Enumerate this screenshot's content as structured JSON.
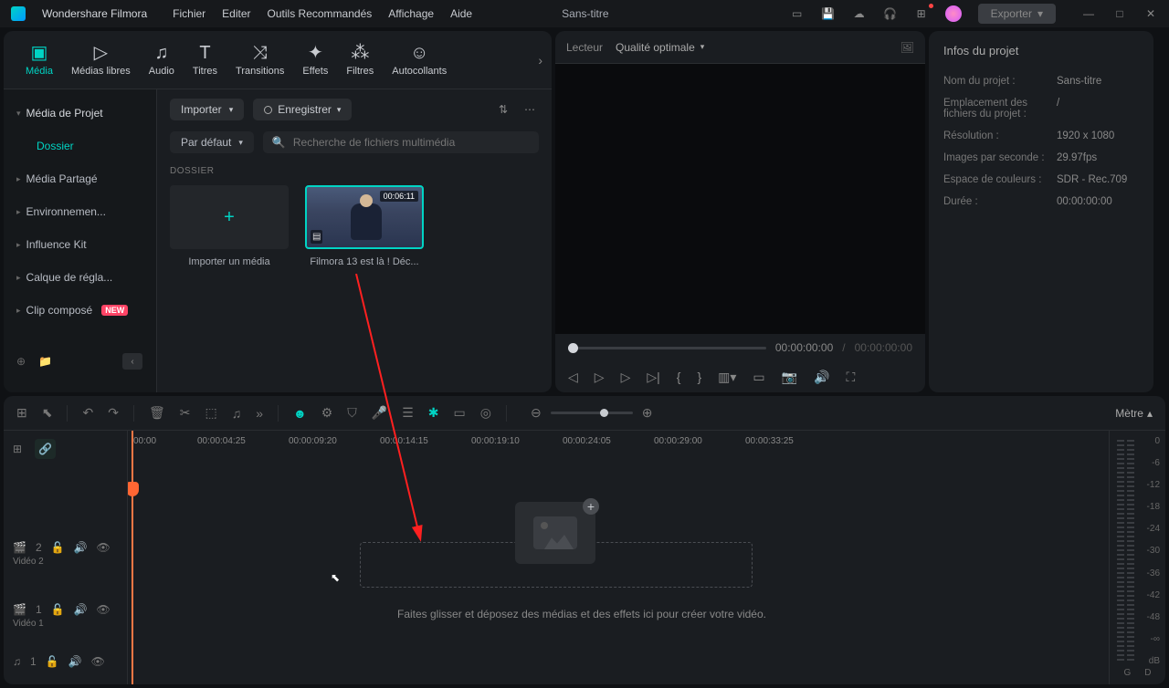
{
  "titlebar": {
    "app_name": "Wondershare Filmora",
    "menus": [
      "Fichier",
      "Editer",
      "Outils Recommandés",
      "Affichage",
      "Aide"
    ],
    "title": "Sans-titre",
    "export_label": "Exporter"
  },
  "media_tabs": [
    {
      "icon": "▣",
      "label": "Média",
      "active": true
    },
    {
      "icon": "▢",
      "label": "Médias libres"
    },
    {
      "icon": "♫",
      "label": "Audio"
    },
    {
      "icon": "T",
      "label": "Titres"
    },
    {
      "icon": "⇄",
      "label": "Transitions"
    },
    {
      "icon": "✦",
      "label": "Effets"
    },
    {
      "icon": "❄",
      "label": "Filtres"
    },
    {
      "icon": "☺",
      "label": "Autocollants"
    }
  ],
  "sidebar": {
    "items": [
      {
        "label": "Média de Projet",
        "caret": true,
        "bold": true
      },
      {
        "label": "Dossier",
        "sub": true,
        "active": true
      },
      {
        "label": "Média Partagé",
        "caret": true
      },
      {
        "label": "Environnemen...",
        "caret": true
      },
      {
        "label": "Influence Kit",
        "caret": true
      },
      {
        "label": "Calque de régla...",
        "caret": true
      },
      {
        "label": "Clip composé",
        "caret": true,
        "new": true
      }
    ]
  },
  "content": {
    "import_label": "Importer",
    "record_label": "Enregistrer",
    "sort_label": "Par défaut",
    "search_placeholder": "Recherche de fichiers multimédia",
    "section_label": "DOSSIER",
    "import_tile_label": "Importer un média",
    "clip_name": "Filmora 13 est là ! Déc...",
    "clip_duration": "00:06:11"
  },
  "preview": {
    "player_label": "Lecteur",
    "quality_label": "Qualité optimale",
    "current_time": "00:00:00:00",
    "total_time": "00:00:00:00"
  },
  "info_panel": {
    "title": "Infos du projet",
    "rows": [
      {
        "k": "Nom du projet :",
        "v": "Sans-titre"
      },
      {
        "k": "Emplacement des fichiers du projet :",
        "v": "/"
      },
      {
        "k": "Résolution :",
        "v": "1920 x 1080"
      },
      {
        "k": "Images par seconde :",
        "v": "29.97fps"
      },
      {
        "k": "Espace de couleurs :",
        "v": "SDR - Rec.709"
      },
      {
        "k": "Durée :",
        "v": "00:00:00:00"
      }
    ]
  },
  "timeline": {
    "meter_label": "Mètre",
    "timecodes": [
      "00:00",
      "00:00:04:25",
      "00:00:09:20",
      "00:00:14:15",
      "00:00:19:10",
      "00:00:24:05",
      "00:00:29:00",
      "00:00:33:25"
    ],
    "drop_text": "Faites glisser et déposez des médias et des effets ici pour créer votre vidéo.",
    "tracks": [
      {
        "icon": "🎬",
        "num": "2",
        "label": "Vidéo 2"
      },
      {
        "icon": "🎬",
        "num": "1",
        "label": "Vidéo 1"
      },
      {
        "icon": "♫",
        "num": "1",
        "label": ""
      }
    ],
    "db_values": [
      "0",
      "-6",
      "-12",
      "-18",
      "-24",
      "-30",
      "-36",
      "-42",
      "-48",
      "-∞",
      "dB"
    ],
    "db_channels": [
      "G",
      "D"
    ]
  }
}
